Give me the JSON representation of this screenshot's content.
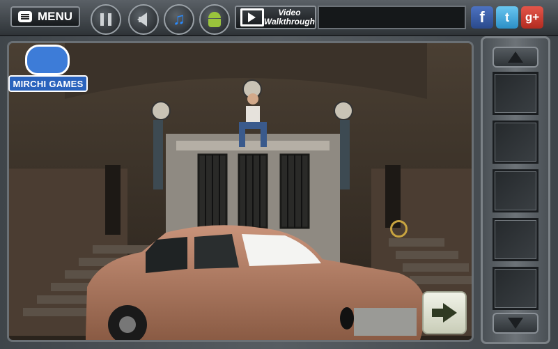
{
  "toolbar": {
    "menu_label": "MENU",
    "video_label_line1": "Video",
    "video_label_line2": "Walkthrough",
    "facebook_glyph": "f",
    "twitter_glyph": "t",
    "googleplus_glyph": "g+"
  },
  "logo": {
    "text": "MIRCHI GAMES"
  },
  "icons": {
    "pause": "pause-icon",
    "sound": "speaker-icon",
    "music": "music-note-icon",
    "android": "android-icon",
    "video": "film-icon",
    "next": "arrow-right-icon"
  },
  "colors": {
    "frame": "#575d62",
    "logo_blue": "#2a63bd",
    "music_blue": "#2a8bff",
    "android_green": "#9ac43c",
    "facebook": "#3b5998",
    "twitter": "#2b8fc7",
    "googleplus": "#c8352b",
    "hotspot": "#c8a440"
  },
  "inventory": {
    "slot_count": 5
  }
}
